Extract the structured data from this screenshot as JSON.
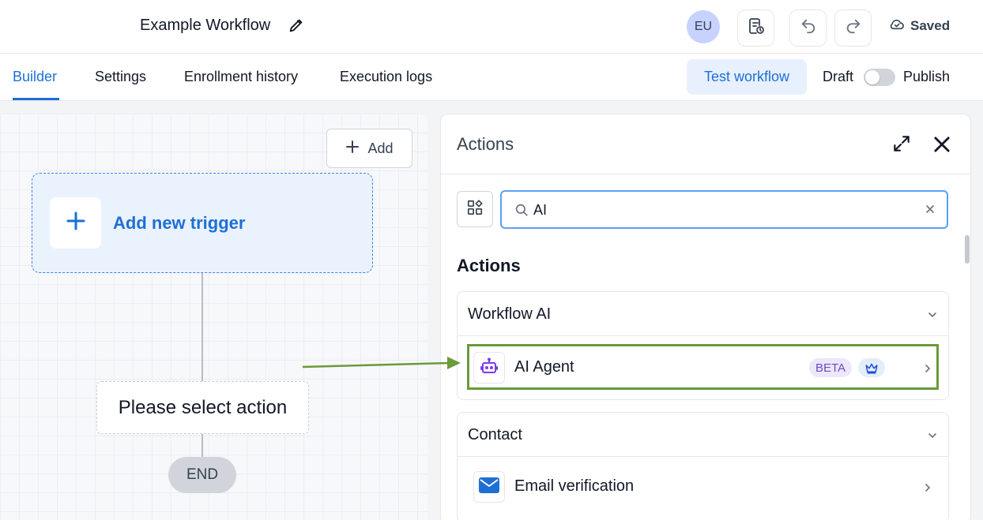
{
  "header": {
    "workflow_title": "Example Workflow",
    "avatar_initials": "EU",
    "saved_label": "Saved"
  },
  "tabs": [
    {
      "label": "Builder",
      "active": true
    },
    {
      "label": "Settings",
      "active": false
    },
    {
      "label": "Enrollment history",
      "active": false
    },
    {
      "label": "Execution logs",
      "active": false
    }
  ],
  "toolbar": {
    "test_label": "Test workflow",
    "draft_label": "Draft",
    "publish_label": "Publish",
    "publish_toggle_on": false
  },
  "canvas": {
    "add_label": "Add",
    "trigger_label": "Add new trigger",
    "select_action_label": "Please select action",
    "end_label": "END"
  },
  "panel": {
    "title": "Actions",
    "search_value": "AI",
    "section_title": "Actions",
    "groups": [
      {
        "title": "Workflow AI",
        "items": [
          {
            "label": "AI Agent",
            "badge": "BETA",
            "icon": "robot-icon",
            "premium": true,
            "highlighted": true
          }
        ]
      },
      {
        "title": "Contact",
        "items": [
          {
            "label": "Email verification",
            "icon": "envelope-icon"
          }
        ]
      }
    ]
  },
  "colors": {
    "accent": "#1d6fd6",
    "highlight_border": "#6a9a3a",
    "beta_text": "#6d4cc2"
  }
}
